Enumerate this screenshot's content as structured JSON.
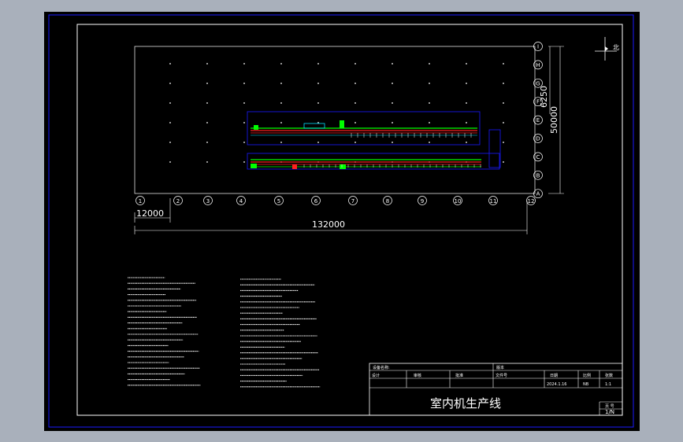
{
  "title_block": {
    "project_title": "室内机生产线",
    "row1_label": "设备名称:",
    "row1_field2": "版本",
    "row2_cells": [
      "设计",
      "审核",
      "批准",
      "文件号",
      "日期",
      "比例",
      "张数"
    ],
    "row3_values": [
      "",
      "",
      "",
      "",
      "2024.1.16",
      "NB",
      "1:1"
    ],
    "sheet_label": "页 号",
    "sheet_value": "1/N"
  },
  "north_arrow": {
    "label": "北"
  },
  "grid_columns": [
    "1",
    "2",
    "3",
    "4",
    "5",
    "6",
    "7",
    "8",
    "9",
    "10",
    "11",
    "12"
  ],
  "grid_rows": [
    "I",
    "H",
    "G",
    "F",
    "E",
    "D",
    "C",
    "B",
    "A"
  ],
  "dimensions": {
    "bay_width": "12000",
    "total_length": "132000",
    "total_width": "50000",
    "row_spacing": "6250"
  },
  "colors": {
    "background_gray": "#a9b0bb",
    "frame_blue": "#1a1aff",
    "cad_white": "#ffffff",
    "line_green": "#00ff00",
    "line_red": "#ff2020",
    "line_cyan": "#00e0ff"
  },
  "notes": {
    "left_column": [
      "",
      "",
      "",
      "",
      "",
      "",
      "",
      "",
      "",
      "",
      "",
      "",
      "",
      "",
      "",
      "",
      "",
      "",
      "",
      ""
    ],
    "right_column": [
      "",
      "",
      "",
      "",
      "",
      "",
      "",
      "",
      "",
      "",
      "",
      "",
      "",
      "",
      "",
      "",
      "",
      "",
      "",
      ""
    ]
  }
}
